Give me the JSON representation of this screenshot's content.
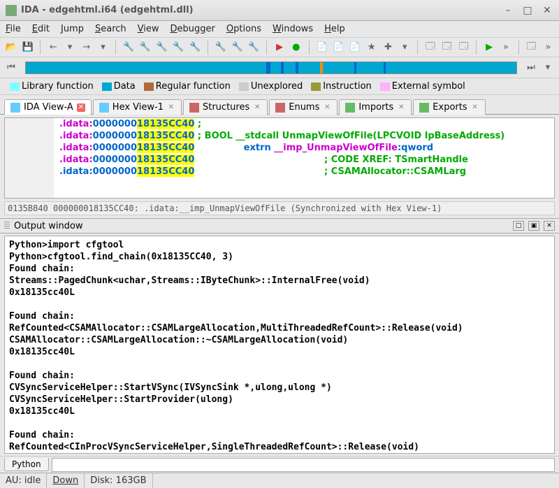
{
  "title": "IDA - edgehtml.i64 (edgehtml.dll)",
  "menu": [
    "File",
    "Edit",
    "Jump",
    "Search",
    "View",
    "Debugger",
    "Options",
    "Windows",
    "Help"
  ],
  "legend": [
    {
      "label": "Library function",
      "color": "#7fffff"
    },
    {
      "label": "Data",
      "color": "#00a7d0"
    },
    {
      "label": "Regular function",
      "color": "#b06a3a"
    },
    {
      "label": "Unexplored",
      "color": "#cccccc"
    },
    {
      "label": "Instruction",
      "color": "#9a9a3a"
    },
    {
      "label": "External symbol",
      "color": "#ffb0ff"
    }
  ],
  "tabs": [
    {
      "label": "IDA View-A",
      "icon": "#6cf",
      "active": true,
      "closeRed": true
    },
    {
      "label": "Hex View-1",
      "icon": "#6cf"
    },
    {
      "label": "Structures",
      "icon": "#c66"
    },
    {
      "label": "Enums",
      "icon": "#c66"
    },
    {
      "label": "Imports",
      "icon": "#6b6"
    },
    {
      "label": "Exports",
      "icon": "#6b6"
    }
  ],
  "code": {
    "seg": ".idata:",
    "blueAddr": "0000000",
    "hlAddr": "18135CC40",
    "l1": " ;",
    "l2a": " ; BOOL __stdcall ",
    "l2b": "UnmapViewOfFile",
    "l2c": "(LPCVOID lpBaseAddress)",
    "l3a": "                 ",
    "l3b": "extrn ",
    "l3c": "__imp_UnmapViewOfFile",
    "l3d": ":qword",
    "l4": "                                         ; CODE XREF: TSmartHandle",
    "l5": "                                         ; CSAMAllocator::CSAMLarg"
  },
  "statusline": "0135B840 000000018135CC40: .idata:__imp_UnmapViewOfFile (Synchronized with Hex View-1)",
  "outHeader": "Output window",
  "output": [
    "Python>import cfgtool",
    "Python>cfgtool.find_chain(0x18135CC40, 3)",
    "Found chain:",
    "Streams::PagedChunk<uchar,Streams::IByteChunk>::InternalFree(void)",
    "0x18135cc40L",
    "",
    "Found chain:",
    "RefCounted<CSAMAllocator::CSAMLargeAllocation,MultiThreadedRefCount>::Release(void)",
    "CSAMAllocator::CSAMLargeAllocation::~CSAMLargeAllocation(void)",
    "0x18135cc40L",
    "",
    "Found chain:",
    "CVSyncServiceHelper::StartVSync(IVSyncSink *,ulong,ulong *)",
    "CVSyncServiceHelper::StartProvider(ulong)",
    "0x18135cc40L",
    "",
    "Found chain:",
    "RefCounted<CInProcVSyncServiceHelper,SingleThreadedRefCount>::Release(void)"
  ],
  "outTab": "Python",
  "status": {
    "au": "AU:  idle",
    "down": "Down",
    "disk": "Disk: 163GB"
  }
}
